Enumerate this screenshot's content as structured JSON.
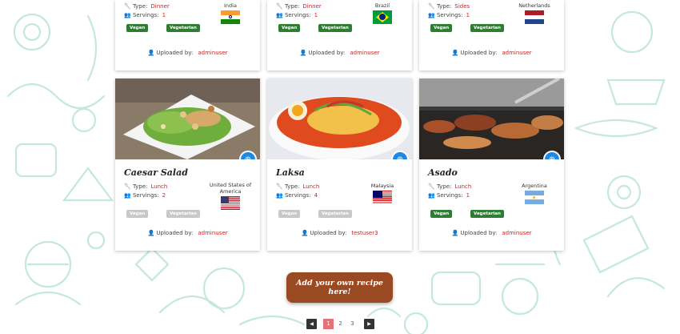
{
  "labels": {
    "type": "Type:",
    "servings": "Servings:",
    "uploaded_by": "Uploaded by:"
  },
  "badges": {
    "vegan": "Vegan",
    "vegetarian": "Vegetarian"
  },
  "top_cards": [
    {
      "type": "Dinner",
      "servings": "1",
      "country": "India",
      "uploader": "adminuser",
      "vegan": true,
      "vegetarian": true
    },
    {
      "type": "Dinner",
      "servings": "1",
      "country": "Brazil",
      "uploader": "adminuser",
      "vegan": true,
      "vegetarian": true
    },
    {
      "type": "Sides",
      "servings": "1",
      "country": "Netherlands",
      "uploader": "adminuser",
      "vegan": true,
      "vegetarian": true
    }
  ],
  "cards": [
    {
      "title": "Caesar Salad",
      "type": "Lunch",
      "servings": "2",
      "country": "United States of America",
      "uploader": "adminuser",
      "vegan": false,
      "vegetarian": false
    },
    {
      "title": "Laksa",
      "type": "Lunch",
      "servings": "4",
      "country": "Malaysia",
      "uploader": "testuser3",
      "vegan": false,
      "vegetarian": false
    },
    {
      "title": "Asado",
      "type": "Lunch",
      "servings": "1",
      "country": "Argentina",
      "uploader": "adminuser",
      "vegan": true,
      "vegetarian": true
    }
  ],
  "add_recipe_button": "Add your own recipe here!",
  "pagination": {
    "prev": "◀",
    "pages": [
      "1",
      "2",
      "3"
    ],
    "next": "▶",
    "active": "1"
  },
  "colors": {
    "accent": "#9a4a23",
    "badge_green": "#2e7d32",
    "value_red": "#c62828",
    "doodle": "#bfe6d6"
  }
}
